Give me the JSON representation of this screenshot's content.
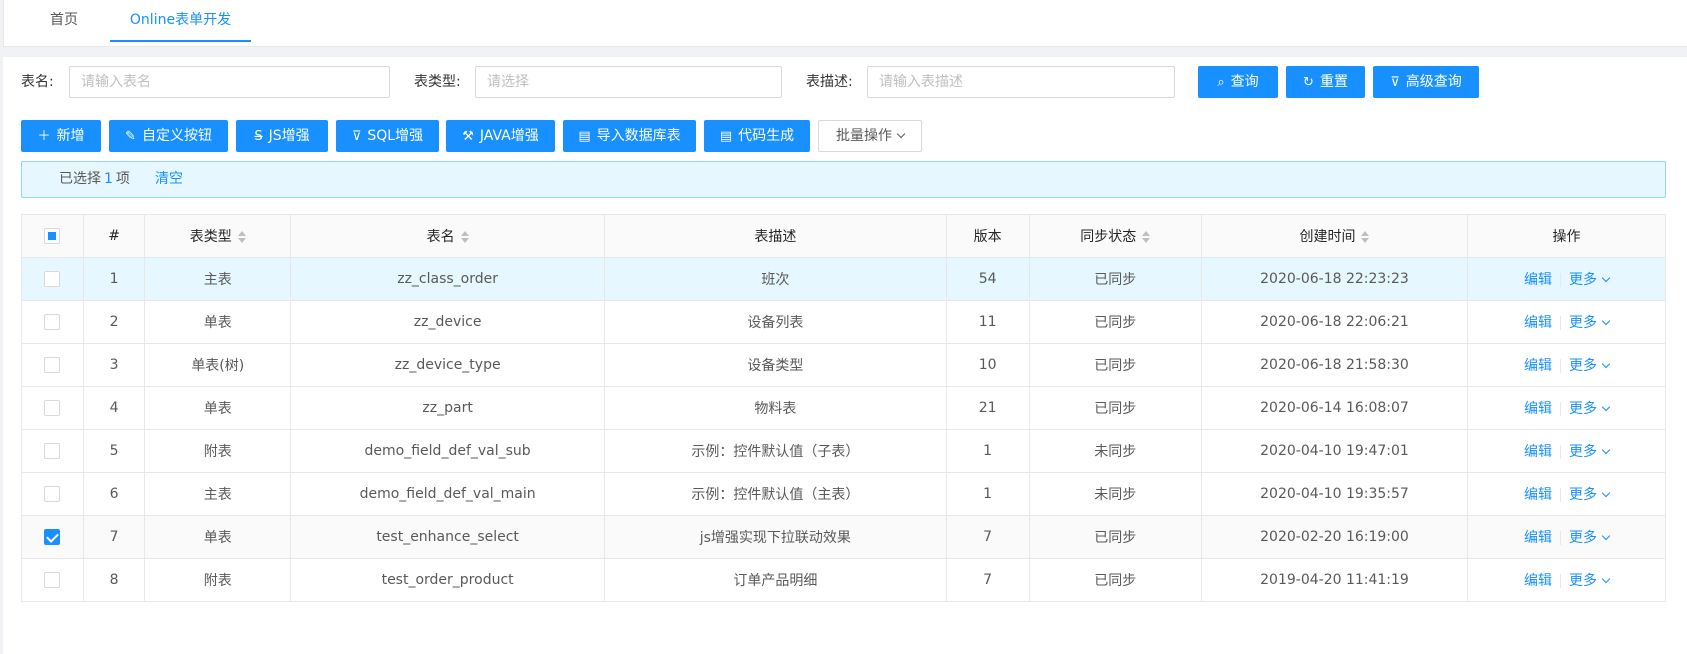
{
  "tabs": [
    {
      "label": "首页"
    },
    {
      "label": "Online表单开发"
    }
  ],
  "search": {
    "table_name_label": "表名:",
    "table_name_placeholder": "请输入表名",
    "table_type_label": "表类型:",
    "table_type_placeholder": "请选择",
    "table_desc_label": "表描述:",
    "table_desc_placeholder": "请输入表描述",
    "query_label": "查询",
    "reset_label": "重置",
    "advanced_label": "高级查询"
  },
  "toolbar": {
    "add_label": "新增",
    "custom_button_label": "自定义按钮",
    "js_label": "JS增强",
    "sql_label": "SQL增强",
    "java_label": "JAVA增强",
    "import_label": "导入数据库表",
    "codegen_label": "代码生成",
    "batch_label": "批量操作"
  },
  "selection": {
    "prefix": "已选择",
    "count": "1",
    "suffix": "项",
    "clear_label": "清空"
  },
  "table": {
    "columns": [
      "#",
      "表类型",
      "表名",
      "表描述",
      "版本",
      "同步状态",
      "创建时间",
      "操作"
    ],
    "edit_label": "编辑",
    "more_label": "更多",
    "rows": [
      {
        "idx": "1",
        "type": "主表",
        "name": "zz_class_order",
        "desc": "班次",
        "version": "54",
        "status": "已同步",
        "synced": true,
        "created": "2020-06-18 22:23:23",
        "checked": false
      },
      {
        "idx": "2",
        "type": "单表",
        "name": "zz_device",
        "desc": "设备列表",
        "version": "11",
        "status": "已同步",
        "synced": true,
        "created": "2020-06-18 22:06:21",
        "checked": false
      },
      {
        "idx": "3",
        "type": "单表(树)",
        "name": "zz_device_type",
        "desc": "设备类型",
        "version": "10",
        "status": "已同步",
        "synced": true,
        "created": "2020-06-18 21:58:30",
        "checked": false
      },
      {
        "idx": "4",
        "type": "单表",
        "name": "zz_part",
        "desc": "物料表",
        "version": "21",
        "status": "已同步",
        "synced": true,
        "created": "2020-06-14 16:08:07",
        "checked": false
      },
      {
        "idx": "5",
        "type": "附表",
        "name": "demo_field_def_val_sub",
        "desc": "示例：控件默认值（子表）",
        "version": "1",
        "status": "未同步",
        "synced": false,
        "created": "2020-04-10 19:47:01",
        "checked": false
      },
      {
        "idx": "6",
        "type": "主表",
        "name": "demo_field_def_val_main",
        "desc": "示例：控件默认值（主表）",
        "version": "1",
        "status": "未同步",
        "synced": false,
        "created": "2020-04-10 19:35:57",
        "checked": false
      },
      {
        "idx": "7",
        "type": "单表",
        "name": "test_enhance_select",
        "desc": "js增强实现下拉联动效果",
        "version": "7",
        "status": "已同步",
        "synced": true,
        "created": "2020-02-20 16:19:00",
        "checked": true
      },
      {
        "idx": "8",
        "type": "附表",
        "name": "test_order_product",
        "desc": "订单产品明细",
        "version": "7",
        "status": "已同步",
        "synced": true,
        "created": "2019-04-20 11:41:19",
        "checked": false
      }
    ]
  }
}
